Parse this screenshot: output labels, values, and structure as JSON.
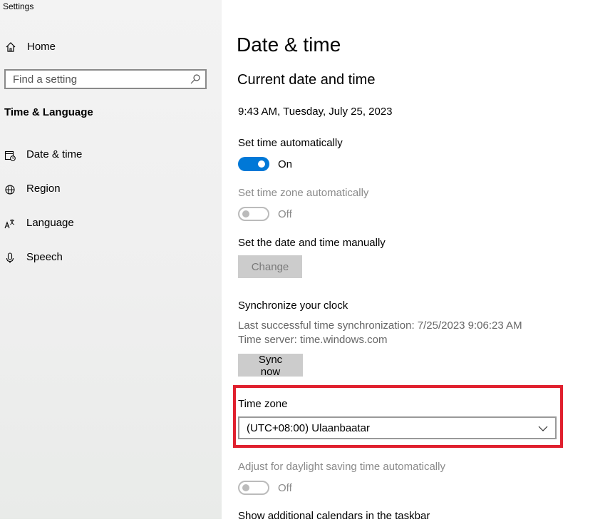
{
  "window": {
    "title": "Settings"
  },
  "sidebar": {
    "home_label": "Home",
    "search_placeholder": "Find a setting",
    "section_title": "Time & Language",
    "items": [
      {
        "label": "Date & time",
        "icon": "calendar-clock-icon"
      },
      {
        "label": "Region",
        "icon": "globe-icon"
      },
      {
        "label": "Language",
        "icon": "language-icon"
      },
      {
        "label": "Speech",
        "icon": "microphone-icon"
      }
    ]
  },
  "main": {
    "page_title": "Date & time",
    "section_title": "Current date and time",
    "current_datetime": "9:43 AM, Tuesday, July 25, 2023",
    "set_time_auto": {
      "label": "Set time automatically",
      "state_label": "On"
    },
    "set_timezone_auto": {
      "label": "Set time zone automatically",
      "state_label": "Off"
    },
    "manual": {
      "label": "Set the date and time manually",
      "button_label": "Change"
    },
    "sync": {
      "title": "Synchronize your clock",
      "last_sync": "Last successful time synchronization: 7/25/2023 9:06:23 AM",
      "server": "Time server: time.windows.com",
      "button_label": "Sync now"
    },
    "timezone": {
      "label": "Time zone",
      "value": "(UTC+08:00) Ulaanbaatar"
    },
    "dst": {
      "label": "Adjust for daylight saving time automatically",
      "state_label": "Off"
    },
    "calendars_label": "Show additional calendars in the taskbar"
  },
  "colors": {
    "accent": "#0078d7",
    "highlight": "#e0202e"
  }
}
